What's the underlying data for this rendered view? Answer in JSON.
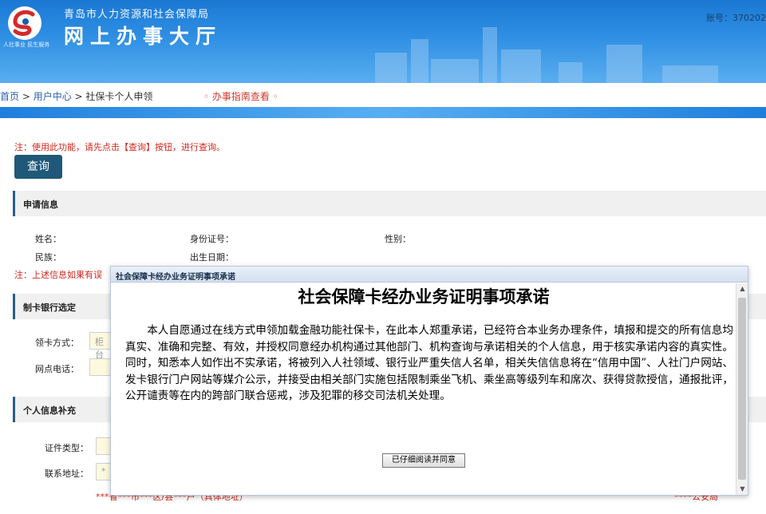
{
  "header": {
    "org_name": "青岛市人力资源和社会保障局",
    "hall_name": "网上办事大厅",
    "logo_caption": "人社事业 民生服务",
    "account": "账号：370202"
  },
  "breadcrumb": {
    "home": "首页",
    "sep1": " > ",
    "user_center": "用户中心",
    "sep2": " > ",
    "current": "社保卡个人申领",
    "guide": "◦ 办事指南查看 ◦"
  },
  "page": {
    "note_query": "注：使用此功能，请先点击【查询】按钮，进行查询。",
    "query_button": "查询",
    "section_apply": "申请信息",
    "label_name": "姓名：",
    "label_id": "身份证号：",
    "label_gender": "性别：",
    "label_ethnicity": "民族：",
    "label_birth": "出生日期：",
    "note_info": "注：上述信息如果有误",
    "section_bank": "制卡银行选定",
    "label_method": "领卡方式：",
    "method_value": "柜台",
    "label_phone": "网点电话：",
    "section_supplement": "个人信息补充",
    "label_doc_type": "证件类型：",
    "label_address": "联系地址：",
    "address_value": "*",
    "bottom_hint": "***省***市***区/县***户（具体地址）",
    "bottom_hint_right": "****公安局"
  },
  "modal": {
    "titlebar": "社会保障卡经办业务证明事项承诺",
    "heading": "社会保障卡经办业务证明事项承诺",
    "body": "本人自愿通过在线方式申领加载金融功能社保卡，在此本人郑重承诺，已经符合本业务办理条件，填报和提交的所有信息均真实、准确和完整、有效，并授权同意经办机构通过其他部门、机构查询与承诺相关的个人信息，用于核实承诺内容的真实性。同时，知悉本人如作出不实承诺，将被列入人社领域、银行业严重失信人名单，相关失信信息将在“信用中国”、人社门户网站、发卡银行门户网站等媒介公示，并接受由相关部门实施包括限制乘坐飞机、乘坐高等级列车和席次、获得贷款授信，通报批评，公开谴责等在内的跨部门联合惩戒，涉及犯罪的移交司法机关处理。",
    "agree_button": "已仔细阅读并同意",
    "scroll_up": "▲",
    "scroll_down": "▼"
  },
  "colors": {
    "header_blue": "#1a78d4",
    "query_button": "#1f5878",
    "warning_red": "#d0281e",
    "field_yellow": "#fdf9df"
  }
}
